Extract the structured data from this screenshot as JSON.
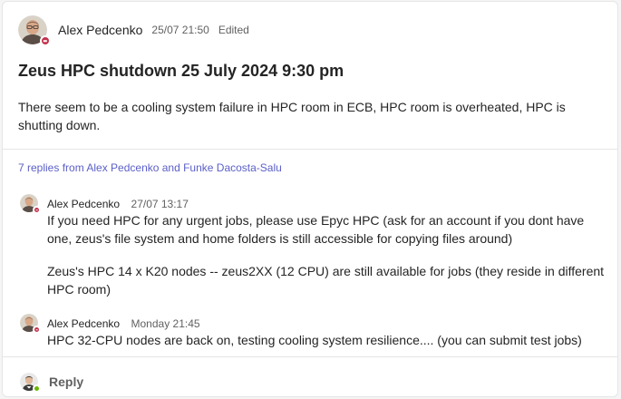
{
  "post": {
    "author": "Alex Pedcenko",
    "timestamp": "25/07 21:50",
    "edited": "Edited",
    "subject": "Zeus HPC shutdown 25 July 2024 9:30 pm",
    "body": "There seem to be a cooling system failure in HPC room in ECB, HPC room is overheated, HPC is shutting down.",
    "presence": "do-not-disturb-icon"
  },
  "replies_link": "7 replies from Alex Pedcenko and Funke Dacosta-Salu",
  "replies": [
    {
      "author": "Alex Pedcenko",
      "timestamp": "27/07 13:17",
      "paragraphs": [
        "If you need HPC for any urgent jobs, please use Epyc HPC (ask for an account if you dont have one, zeus's file system and home folders is still accessible for copying files around)",
        "Zeus's HPC 14 x K20 nodes --  zeus2XX (12 CPU)  are still available for jobs (they reside in different HPC room)"
      ]
    },
    {
      "author": "Alex Pedcenko",
      "timestamp": "Monday 21:45",
      "paragraphs": [
        "HPC 32-CPU nodes are back on, testing cooling system resilience.... (you can submit test jobs)"
      ]
    }
  ],
  "reply_bar": {
    "label": "Reply",
    "presence": "available-icon"
  },
  "colors": {
    "accent": "#5b5fc7",
    "dnd": "#c4314b",
    "available": "#6bb700"
  }
}
